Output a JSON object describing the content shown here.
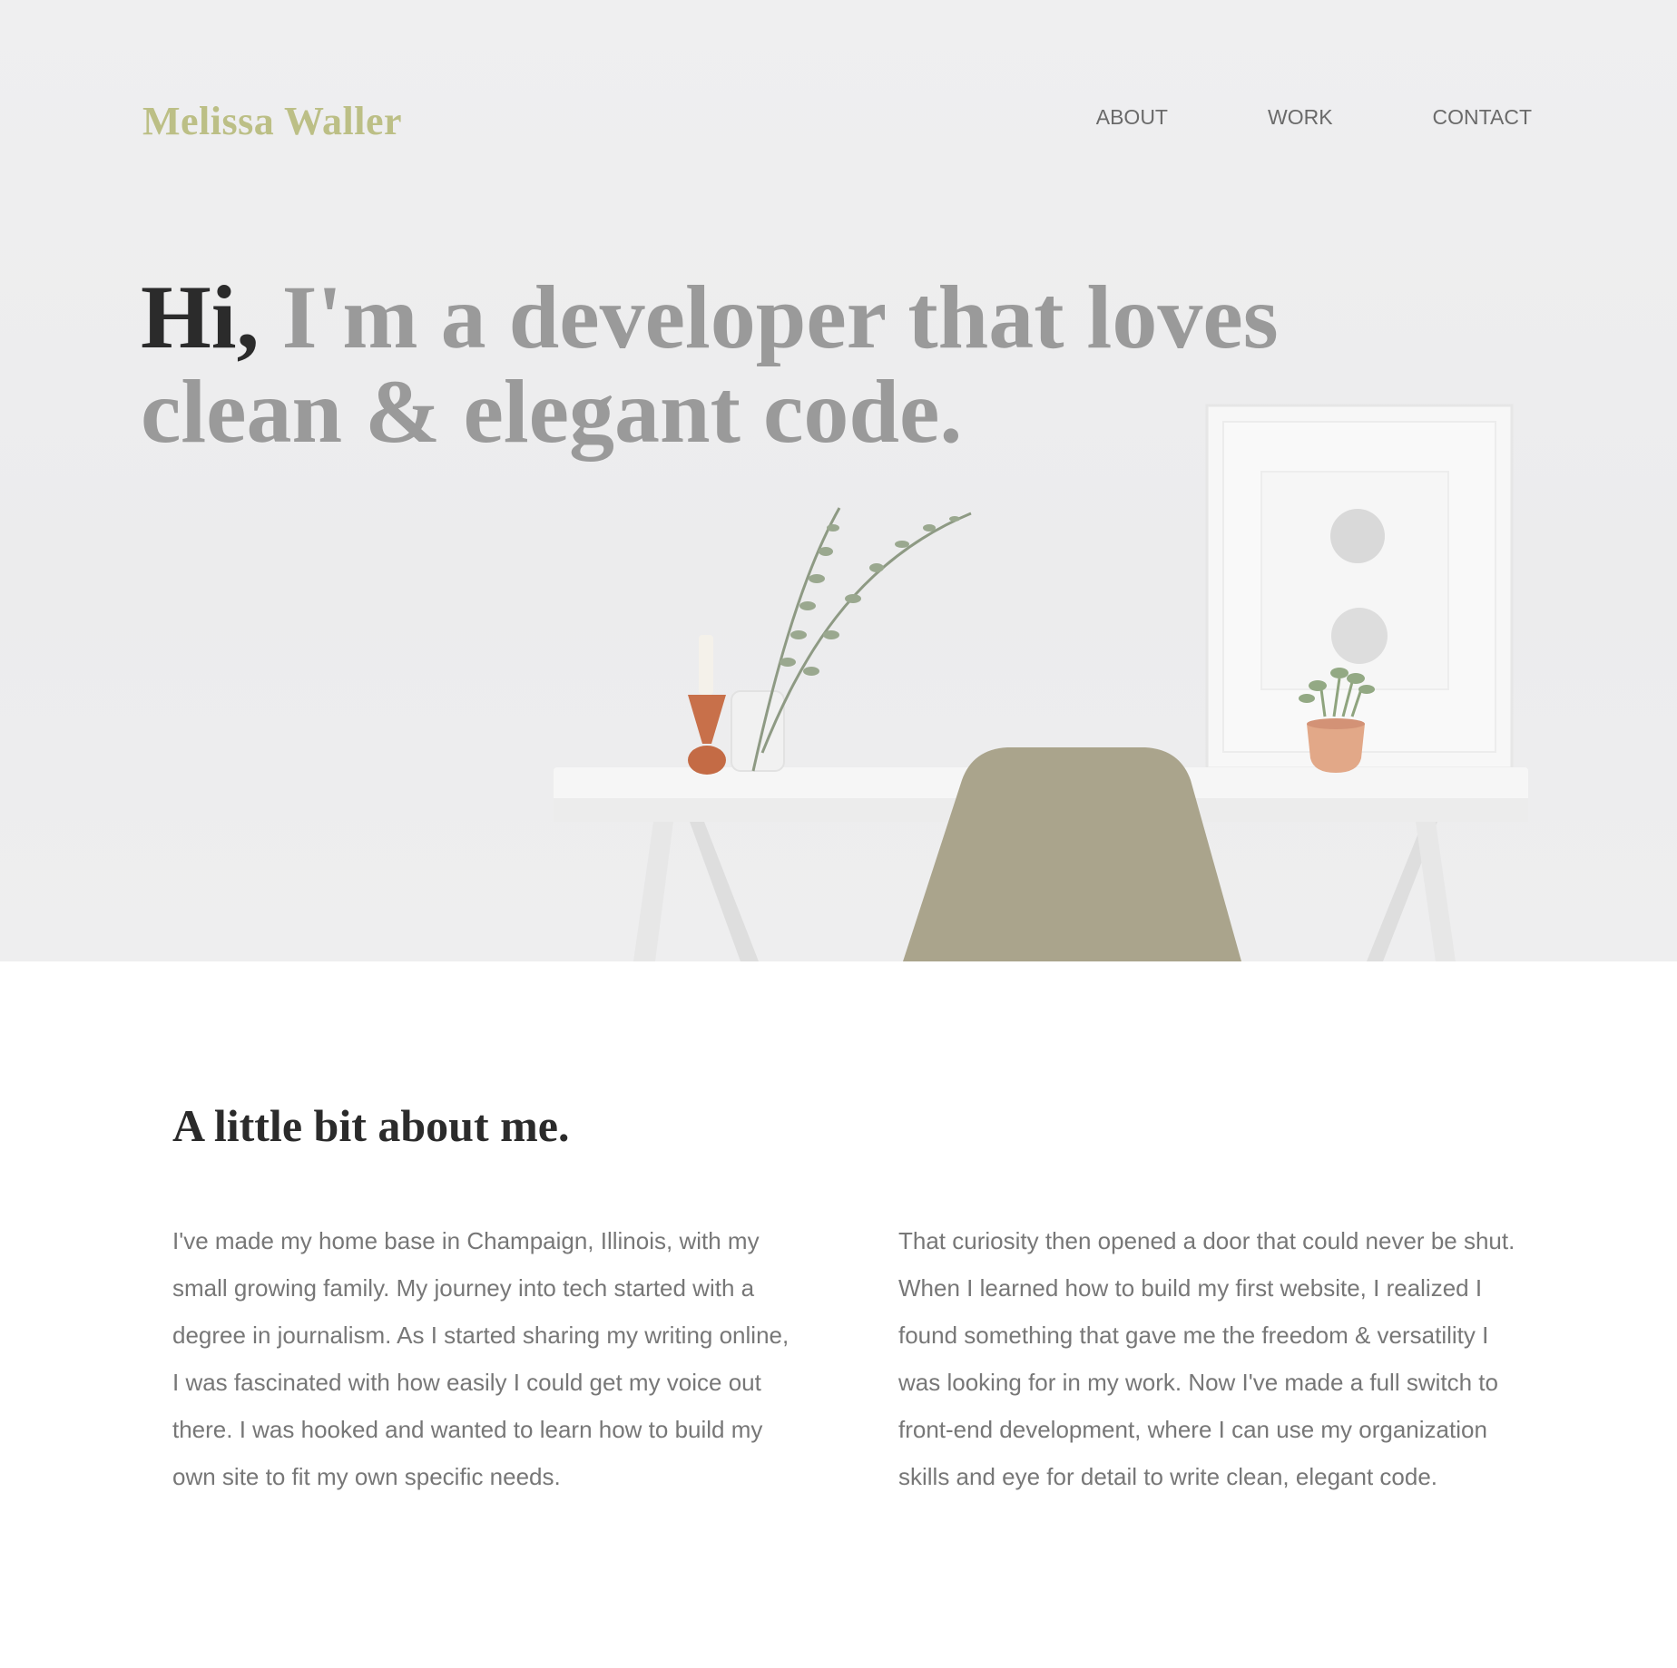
{
  "header": {
    "logo": "Melissa Waller",
    "nav": [
      {
        "label": "ABOUT"
      },
      {
        "label": "WORK"
      },
      {
        "label": "CONTACT"
      }
    ]
  },
  "hero": {
    "greeting": "Hi,",
    "headline": "I'm a developer that loves clean & elegant code."
  },
  "about": {
    "title": "A little bit about me.",
    "paragraphs": [
      "I've made my home base in Champaign, Illinois, with my small growing family. My journey into tech started with a degree in journalism. As I started sharing my writing online, I was fascinated with how easily I could get my voice out there. I was hooked and wanted to learn how to build my own site to fit my own specific needs.",
      "That curiosity then opened a door that could never be shut. When I learned how to build my first website, I realized I found something that gave me the freedom & versatility I was looking for in my work. Now I've made a full switch to front-end development, where I can use my organization skills and eye for detail to write clean, elegant code."
    ]
  },
  "colors": {
    "logo": "#bcbf86",
    "headline_dark": "#2b2b2b",
    "headline_light": "#9a9a9a",
    "body_text": "#777777",
    "chair": "#aaa48c",
    "copper": "#c8704a"
  }
}
